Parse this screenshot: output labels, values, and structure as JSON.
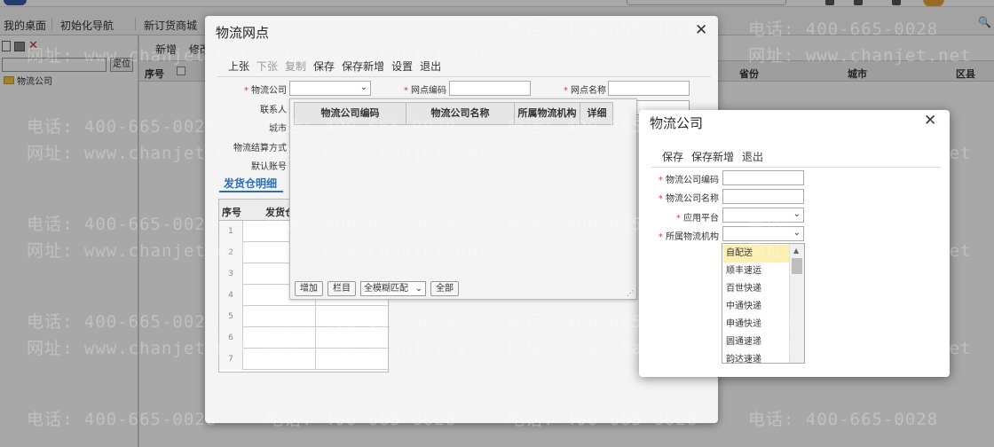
{
  "app": {
    "tabs": [
      "我的桌面",
      "初始化导航",
      "新订货商城"
    ],
    "left_panel": {
      "locate_label": "定位",
      "tree_root": "物流公司"
    },
    "main": {
      "toolbar": [
        "新增",
        "修改"
      ],
      "grid_headers": {
        "index": "序号",
        "province": "省份",
        "city": "城市",
        "district": "区县"
      }
    }
  },
  "watermark": {
    "phone": "电话: 400-665-0028",
    "site": "网址: www.chanjet.net"
  },
  "dialog1": {
    "title": "物流网点",
    "toolbar": [
      {
        "label": "上张",
        "disabled": false
      },
      {
        "label": "下张",
        "disabled": true
      },
      {
        "label": "复制",
        "disabled": true
      },
      {
        "label": "保存",
        "disabled": false
      },
      {
        "label": "保存新增",
        "disabled": false
      },
      {
        "label": "设置",
        "disabled": false
      },
      {
        "label": "退出",
        "disabled": false
      }
    ],
    "fields": {
      "company": "物流公司",
      "code": "网点编码",
      "name": "网点名称",
      "contact": "联系人",
      "city": "城市",
      "settlement": "物流结算方式",
      "default_account": "默认账号"
    },
    "tab_label": "发货仓明细",
    "detail_grid": {
      "headers": [
        "序号",
        "发货仓"
      ],
      "rows": [
        "1",
        "2",
        "3",
        "4",
        "5",
        "6",
        "7"
      ]
    },
    "popup": {
      "headers": [
        "物流公司编码",
        "物流公司名称",
        "所属物流机构",
        "详细"
      ],
      "add_button": "增加",
      "columns_button": "栏目",
      "match_mode": "全模糊匹配",
      "all_button": "全部"
    }
  },
  "dialog2": {
    "title": "物流公司",
    "toolbar": [
      "保存",
      "保存新增",
      "退出"
    ],
    "fields": {
      "code": "物流公司编码",
      "name": "物流公司名称",
      "platform": "应用平台",
      "org": "所属物流机构"
    },
    "dropdown_items": [
      "自配送",
      "顺丰速运",
      "百世快递",
      "中通快递",
      "申通快递",
      "圆通速递",
      "韵达速递"
    ],
    "selected_index": 0
  }
}
